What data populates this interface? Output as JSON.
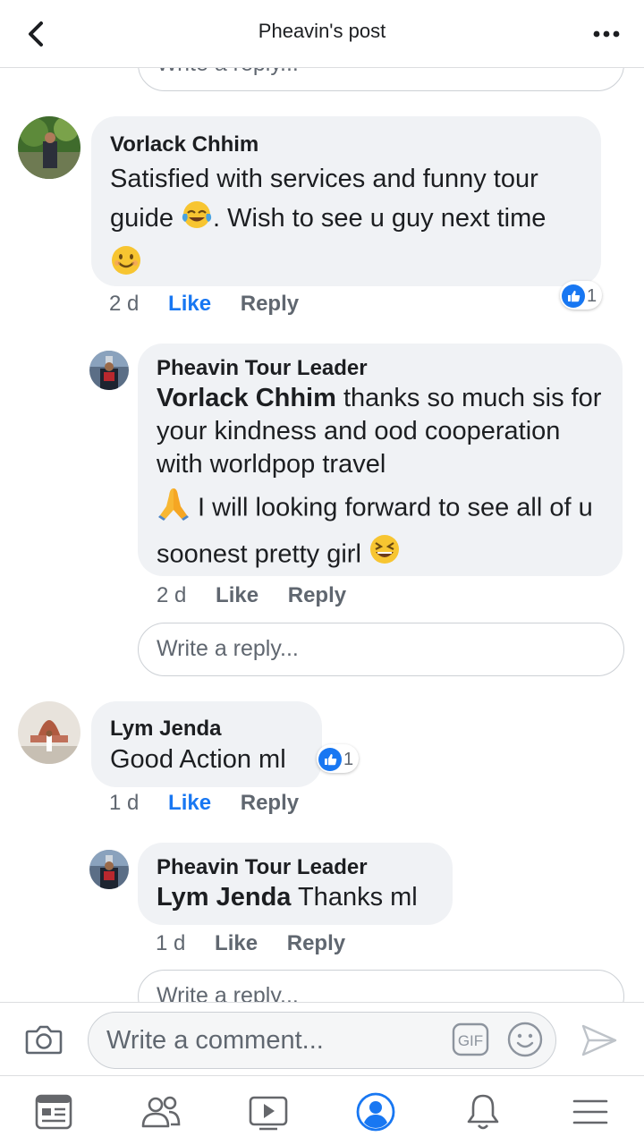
{
  "header": {
    "title": "Pheavin's post",
    "back_icon": "chevron-left-icon",
    "more_icon": "more-horizontal-icon"
  },
  "colors": {
    "accent": "#1877f2",
    "bubble": "#f0f2f5",
    "meta_text": "#606770"
  },
  "top_reply_input": {
    "placeholder": "Write a reply..."
  },
  "comments": [
    {
      "author": "Vorlack Chhim",
      "text_1": "Satisfied with services and funny tour guide",
      "text_2": ". Wish to see u guy next time",
      "emojis": [
        "tears-of-joy-emoji",
        "smiling-face-emoji"
      ],
      "time": "2 d",
      "like_label": "Like",
      "reply_label": "Reply",
      "reaction_count": "1",
      "liked": true,
      "replies": [
        {
          "author": "Pheavin Tour Leader",
          "mention": "Vorlack Chhim",
          "text_1": " thanks so much sis for your kindness and ood cooperation with worldpop travel",
          "text_2": " I will looking forward to see all of u soonest pretty girl",
          "emojis": [
            "folded-hands-emoji",
            "grinning-squinting-emoji"
          ],
          "time": "2 d",
          "like_label": "Like",
          "reply_label": "Reply"
        }
      ],
      "reply_input_placeholder": "Write a reply..."
    },
    {
      "author": "Lym Jenda",
      "text": "Good Action ml",
      "time": "1 d",
      "like_label": "Like",
      "reply_label": "Reply",
      "reaction_count": "1",
      "liked": true,
      "replies": [
        {
          "author": "Pheavin Tour Leader",
          "mention": "Lym Jenda",
          "text": " Thanks ml",
          "time": "1 d",
          "like_label": "Like",
          "reply_label": "Reply"
        }
      ],
      "reply_input_placeholder": "Write a reply..."
    }
  ],
  "composer": {
    "placeholder": "Write a comment...",
    "camera_icon": "camera-icon",
    "gif_icon": "gif-icon",
    "emoji_icon": "smiley-icon",
    "send_icon": "send-icon"
  },
  "tabbar": [
    {
      "name": "news-feed-icon"
    },
    {
      "name": "friends-icon"
    },
    {
      "name": "watch-icon"
    },
    {
      "name": "profile-icon",
      "active": true
    },
    {
      "name": "notifications-bell-icon"
    },
    {
      "name": "menu-icon"
    }
  ]
}
